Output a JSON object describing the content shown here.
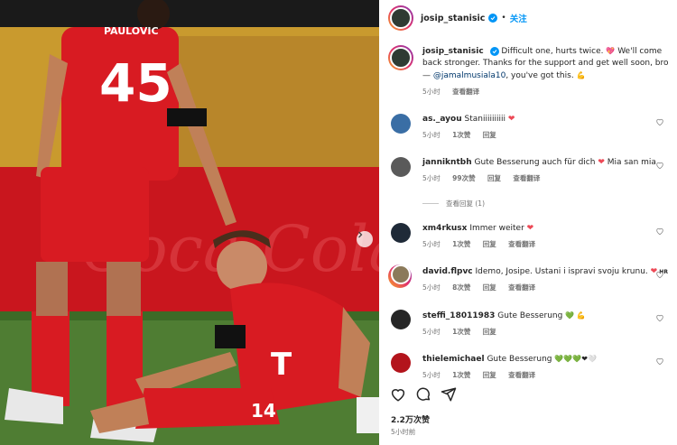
{
  "post": {
    "author": "josip_stanisic",
    "follow_label": "关注",
    "separator": "•",
    "caption_line1": "Difficult one, hurts twice. ",
    "caption_line2": "We'll come back stronger. Thanks for the support and get well soon, bro — ",
    "caption_mention": "@jamalmusiala10",
    "caption_line3": ", you've got this. ",
    "caption_time": "5小时",
    "caption_translate": "查看翻译",
    "likes": "2.2万次赞",
    "time": "5小时前"
  },
  "photo": {
    "player_back_name": "PAULOVIC",
    "player_back_number": "45",
    "seated_player_chest": "T",
    "seated_player_number": "14"
  },
  "comments": [
    {
      "user": "as._ayou",
      "text": "Staniiiiiiiiii",
      "emoji": "❤",
      "time": "5小时",
      "likes": "1次赞",
      "reply": "回复",
      "translate": ""
    },
    {
      "user": "jannikntbh",
      "text": "Gute Besserung auch für dich",
      "emoji": "❤",
      "text2": " Mia san mia",
      "time": "5小时",
      "likes": "99次赞",
      "reply": "回复",
      "translate": "查看翻译"
    },
    {
      "user": "xm4rkusx",
      "text": "Immer weiter",
      "emoji": "❤",
      "time": "5小时",
      "likes": "1次赞",
      "reply": "回复",
      "translate": "查看翻译"
    },
    {
      "user": "david.flpvc",
      "text": "Idemo, Josipe. Ustani i ispravi svoju krunu.",
      "emoji": "❤",
      "text2": " HR",
      "time": "5小时",
      "likes": "8次赞",
      "reply": "回复",
      "translate": "查看翻译"
    },
    {
      "user": "steffi_18011983",
      "text": "Gute Besserung",
      "emoji": "💚",
      "text2": " 💪",
      "time": "5小时",
      "likes": "1次赞",
      "reply": "回复",
      "translate": ""
    },
    {
      "user": "thielemichael",
      "text": "Gute Besserung",
      "emoji": "💚💚💚❤🤍",
      "time": "5小时",
      "likes": "1次赞",
      "reply": "回复",
      "translate": "查看翻译"
    }
  ],
  "view_replies": "查看回复 (1)",
  "colors": {
    "accent": "#0095f6",
    "like_red": "#ed4956",
    "meta_gray": "#737373",
    "bayern_red": "#dc052d"
  },
  "icons": [
    "verified-badge-icon",
    "heart-icon",
    "comment-icon",
    "share-icon",
    "chevron-right-icon"
  ]
}
